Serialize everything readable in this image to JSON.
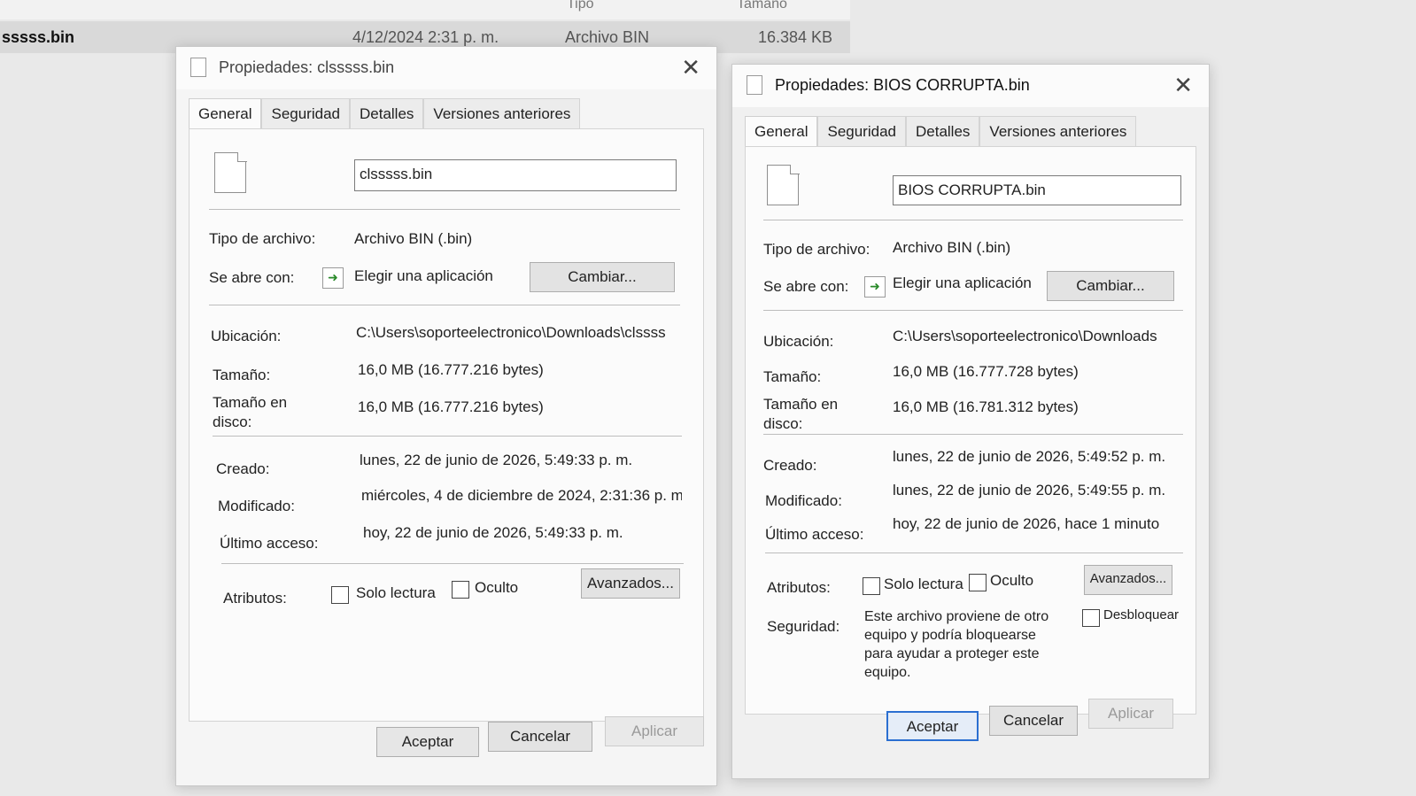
{
  "explorer": {
    "header_type": "Tipo",
    "header_size": "Tamaño",
    "row_name": "sssss.bin",
    "row_date": "4/12/2024 2:31 p. m.",
    "row_type": "Archivo BIN",
    "row_size": "16.384 KB"
  },
  "dialog1": {
    "title": "Propiedades: clsssss.bin",
    "tabs": [
      "General",
      "Seguridad",
      "Detalles",
      "Versiones anteriores"
    ],
    "filename": "clsssss.bin",
    "labels": {
      "tipo": "Tipo de archivo:",
      "abre": "Se abre con:",
      "ubicacion": "Ubicación:",
      "tamano": "Tamaño:",
      "tamano_disco": "Tamaño en disco:",
      "creado": "Creado:",
      "modificado": "Modificado:",
      "acceso": "Último acceso:",
      "atributos": "Atributos:"
    },
    "tipo": "Archivo BIN (.bin)",
    "abre": "Elegir una aplicación",
    "cambiar": "Cambiar...",
    "ubicacion": "C:\\Users\\soporteelectronico\\Downloads\\clssss",
    "tamano": "16,0 MB (16.777.216 bytes)",
    "tamano_disco": "16,0 MB (16.777.216 bytes)",
    "creado": "lunes, 22 de junio de 2026, 5:49:33 p. m.",
    "modificado": "miércoles, 4 de diciembre de 2024, 2:31:36 p. m.",
    "acceso": "hoy, 22 de junio de 2026, 5:49:33 p. m.",
    "solo_lectura": "Solo lectura",
    "oculto": "Oculto",
    "avanzados": "Avanzados...",
    "aceptar": "Aceptar",
    "cancelar": "Cancelar",
    "aplicar": "Aplicar"
  },
  "dialog2": {
    "title": "Propiedades: BIOS CORRUPTA.bin",
    "tabs": [
      "General",
      "Seguridad",
      "Detalles",
      "Versiones anteriores"
    ],
    "filename": "BIOS CORRUPTA.bin",
    "labels": {
      "tipo": "Tipo de archivo:",
      "abre": "Se abre con:",
      "ubicacion": "Ubicación:",
      "tamano": "Tamaño:",
      "tamano_disco": "Tamaño en disco:",
      "creado": "Creado:",
      "modificado": "Modificado:",
      "acceso": "Último acceso:",
      "atributos": "Atributos:",
      "seguridad": "Seguridad:"
    },
    "tipo": "Archivo BIN (.bin)",
    "abre": "Elegir una aplicación",
    "cambiar": "Cambiar...",
    "ubicacion": "C:\\Users\\soporteelectronico\\Downloads",
    "tamano": "16,0 MB (16.777.728 bytes)",
    "tamano_disco": "16,0 MB (16.781.312 bytes)",
    "creado": "lunes, 22 de junio de 2026, 5:49:52 p. m.",
    "modificado": "lunes, 22 de junio de 2026, 5:49:55 p. m.",
    "acceso": "hoy, 22 de junio de 2026, hace 1 minuto",
    "solo_lectura": "Solo lectura",
    "oculto": "Oculto",
    "avanzados": "Avanzados...",
    "seguridad_texto": "Este archivo proviene de otro equipo y podría bloquearse para ayudar a proteger este equipo.",
    "desbloquear": "Desbloquear",
    "aceptar": "Aceptar",
    "cancelar": "Cancelar",
    "aplicar": "Aplicar"
  }
}
